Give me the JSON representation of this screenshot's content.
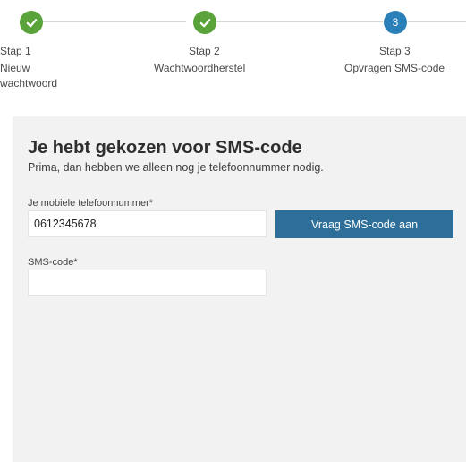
{
  "stepper": {
    "steps": [
      {
        "label": "Stap 1",
        "description": "Nieuw wachtwoord",
        "state": "done",
        "icon": "checkmark-icon"
      },
      {
        "label": "Stap 2",
        "description": "Wachtwoordherstel",
        "state": "done",
        "icon": "checkmark-icon"
      },
      {
        "label": "Stap 3",
        "description": "Opvragen SMS-code",
        "state": "current",
        "number": "3"
      }
    ],
    "colors": {
      "done": "#5aa33a",
      "current": "#2b80b9",
      "line": "#d6d6d6"
    }
  },
  "panel": {
    "title": "Je hebt gekozen voor SMS-code",
    "subtitle": "Prima, dan hebben we alleen nog je telefoonnummer nodig.",
    "phone": {
      "label": "Je mobiele telefoonnummer*",
      "value": "0612345678"
    },
    "request_button": {
      "label": "Vraag SMS-code aan",
      "color": "#2e6f99"
    },
    "sms": {
      "label": "SMS-code*",
      "value": ""
    },
    "background": "#f2f2f2"
  }
}
